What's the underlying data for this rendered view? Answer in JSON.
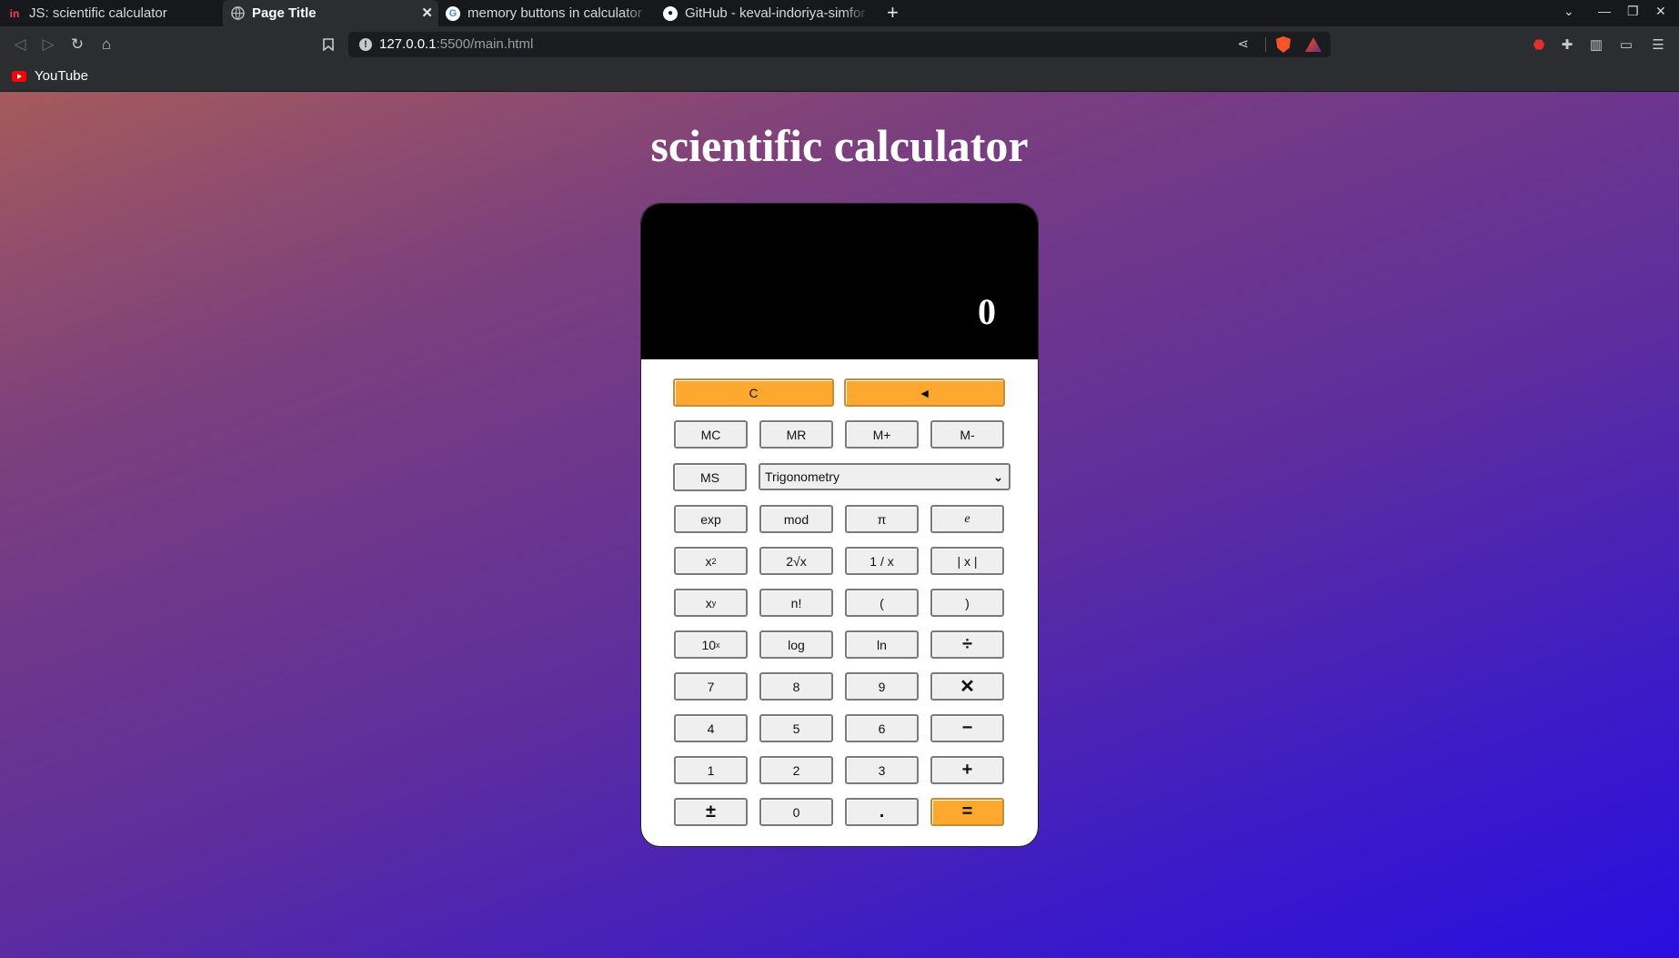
{
  "browser": {
    "tabs": [
      {
        "title": "JS: scientific calculator",
        "favicon": "invision-icon"
      },
      {
        "title": "Page Title",
        "favicon": "globe-icon",
        "active": true
      },
      {
        "title": "memory buttons in calculator",
        "favicon": "google-icon"
      },
      {
        "title": "GitHub - keval-indoriya-simfor",
        "favicon": "github-icon"
      }
    ],
    "url_host": "127.0.0.1",
    "url_rest": ":5500/main.html",
    "bookmarks": [
      {
        "label": "YouTube",
        "icon": "youtube-icon"
      }
    ]
  },
  "page": {
    "heading": "scientific calculator",
    "display": "0",
    "controls": {
      "clear": "C",
      "backspace": "◄"
    },
    "memory": [
      "MC",
      "MR",
      "M+",
      "M-",
      "MS"
    ],
    "function_select": {
      "selected": "Trigonometry"
    },
    "keys": {
      "exp": "exp",
      "mod": "mod",
      "pi": "π",
      "e": "e",
      "square_base": "x",
      "square_exp": "2",
      "root": "2√x",
      "reciprocal": "1 / x",
      "abs": "| x |",
      "power_base": "x",
      "power_exp": "y",
      "factorial": "n!",
      "lparen": "(",
      "rparen": ")",
      "ten_base": "10",
      "ten_exp": "x",
      "log": "log",
      "ln": "ln",
      "divide": "÷",
      "seven": "7",
      "eight": "8",
      "nine": "9",
      "multiply": "✕",
      "four": "4",
      "five": "5",
      "six": "6",
      "minus": "−",
      "one": "1",
      "two": "2",
      "three": "3",
      "plus": "+",
      "negate": "±",
      "zero": "0",
      "dot": ".",
      "equals": "="
    }
  },
  "colors": {
    "accent": "#ffa830",
    "display_bg": "#000000",
    "page_gradient_start": "#a45b5c",
    "page_gradient_end": "#2a0ee0"
  }
}
